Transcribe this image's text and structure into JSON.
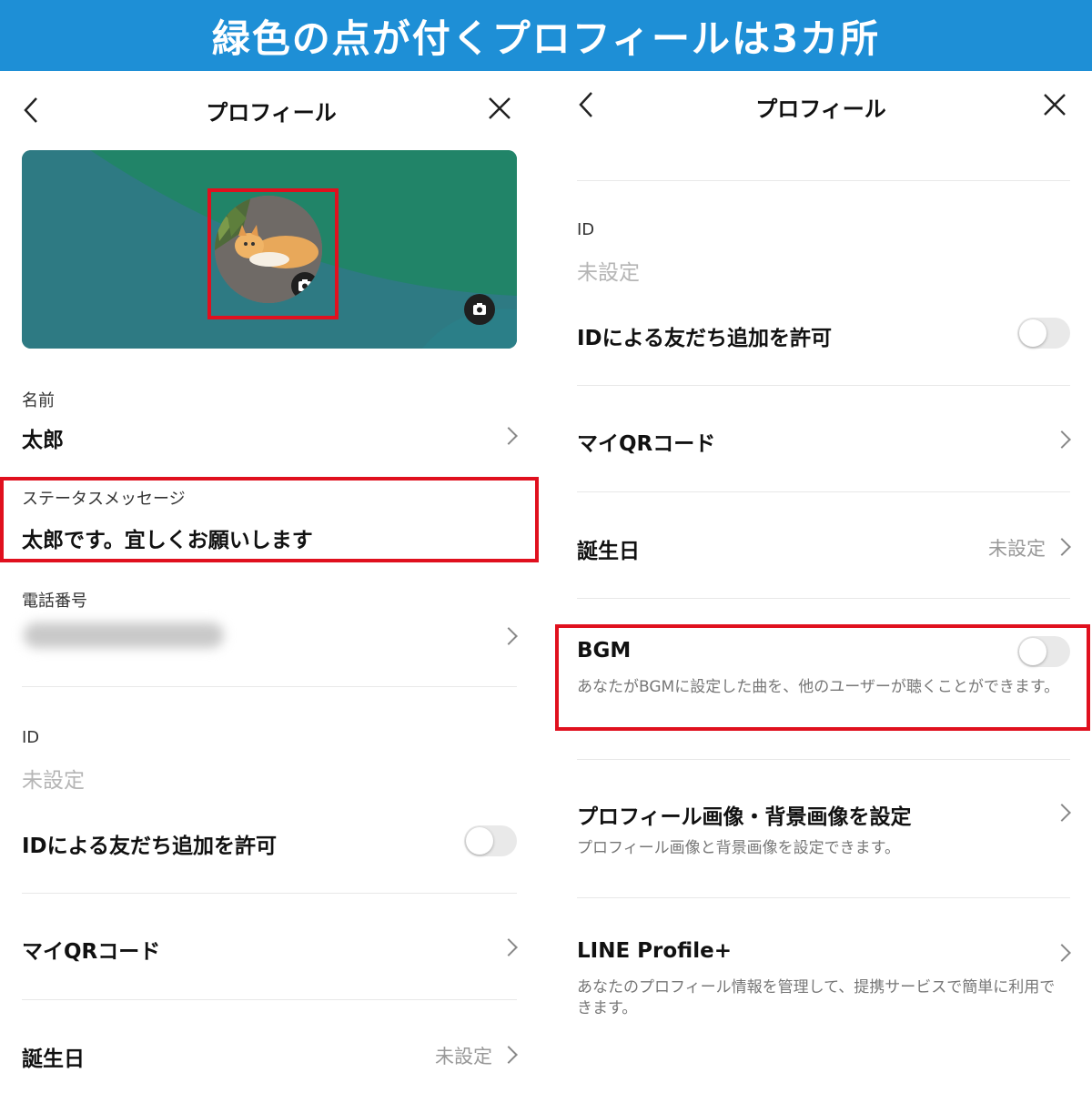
{
  "banner": {
    "text": "緑色の点が付くプロフィールは3カ所"
  },
  "left": {
    "nav": {
      "title": "プロフィール"
    },
    "name": {
      "label": "名前",
      "value": "太郎"
    },
    "status": {
      "label": "ステータスメッセージ",
      "value": "太郎です。宜しくお願いします"
    },
    "phone": {
      "label": "電話番号"
    },
    "id": {
      "label": "ID",
      "value": "未設定"
    },
    "id_allow": {
      "label": "IDによる友だち追加を許可",
      "on": false
    },
    "qr": {
      "label": "マイQRコード"
    },
    "birthday": {
      "label": "誕生日",
      "value": "未設定"
    }
  },
  "right": {
    "nav": {
      "title": "プロフィール"
    },
    "id": {
      "label": "ID",
      "value": "未設定"
    },
    "id_allow": {
      "label": "IDによる友だち追加を許可",
      "on": false
    },
    "qr": {
      "label": "マイQRコード"
    },
    "birthday": {
      "label": "誕生日",
      "value": "未設定"
    },
    "bgm": {
      "label": "BGM",
      "desc": "あなたがBGMに設定した曲を、他のユーザーが聴くことができます。",
      "on": false
    },
    "profile_image": {
      "label": "プロフィール画像・背景画像を設定",
      "desc": "プロフィール画像と背景画像を設定できます。"
    },
    "line_profile_plus": {
      "label": "LINE Profile+",
      "desc": "あなたのプロフィール情報を管理して、提携サービスで簡単に利用できます。"
    }
  },
  "colors": {
    "banner": "#1e8fd6",
    "highlight": "#e0101e",
    "cover": "#217f6a",
    "cover_shade": "#2e7f80"
  }
}
